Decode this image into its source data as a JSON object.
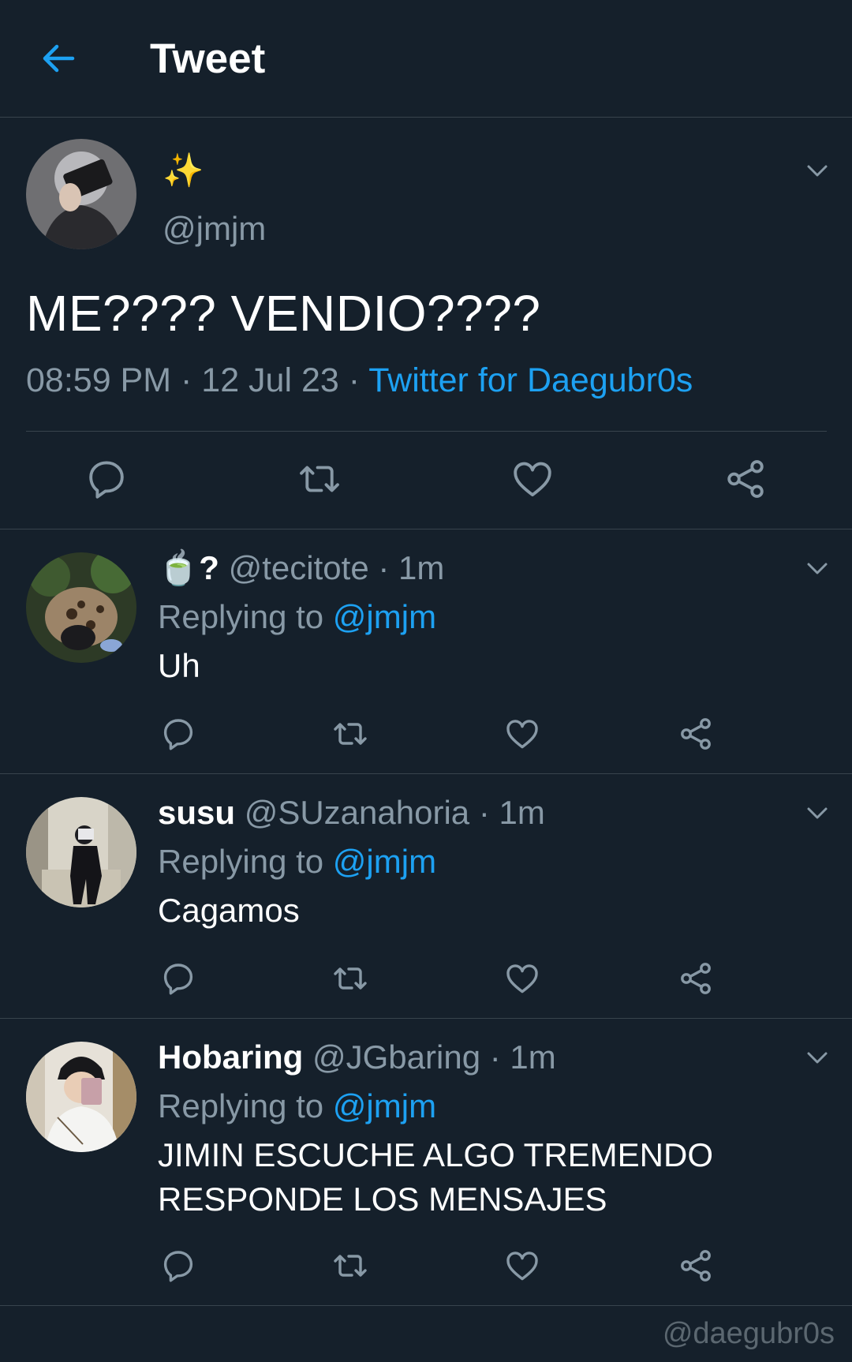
{
  "header": {
    "title": "Tweet",
    "back_icon": "arrow-left-icon"
  },
  "main_tweet": {
    "name": "✨",
    "handle": "@jmjm",
    "text": "ME???? VENDIO????",
    "time": "08:59 PM",
    "date": "12 Jul 23",
    "source": "Twitter for Daegubr0s",
    "separator": " · "
  },
  "replies": [
    {
      "emoji": "🍵?",
      "name": "",
      "handle": "@tecitote",
      "time": "· 1m",
      "replying_prefix": "Replying to ",
      "replying_to": "@jmjm",
      "text": "Uh"
    },
    {
      "emoji": "",
      "name": "susu",
      "handle": "@SUzanahoria",
      "time": "· 1m",
      "replying_prefix": "Replying to ",
      "replying_to": "@jmjm",
      "text": "Cagamos"
    },
    {
      "emoji": "",
      "name": "Hobaring",
      "handle": "@JGbaring",
      "time": "· 1m",
      "replying_prefix": "Replying to ",
      "replying_to": "@jmjm",
      "text": "JIMIN ESCUCHE ALGO TREMENDO RESPONDE LOS MENSAJES"
    }
  ],
  "watermark": "@daegubr0s",
  "colors": {
    "background": "#15202b",
    "accent": "#1da1f2",
    "muted": "#8899a6",
    "border": "#38444d"
  }
}
